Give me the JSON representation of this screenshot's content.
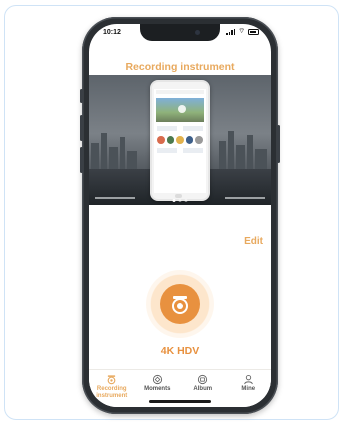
{
  "status_bar": {
    "time": "10:12"
  },
  "app": {
    "title": "Recording instrument",
    "edit_label": "Edit"
  },
  "device": {
    "name": "4K HDV"
  },
  "tabs": [
    {
      "label": "Recording instrument",
      "icon": "dashcam-icon",
      "active": true
    },
    {
      "label": "Moments",
      "icon": "moments-icon",
      "active": false
    },
    {
      "label": "Album",
      "icon": "album-icon",
      "active": false
    },
    {
      "label": "Mine",
      "icon": "person-icon",
      "active": false
    }
  ],
  "colors": {
    "accent": "#e8a95e",
    "accent_strong": "#e8913f",
    "halo": "#fde6cc"
  },
  "banner": {
    "pages": 3,
    "current_page": 1
  }
}
